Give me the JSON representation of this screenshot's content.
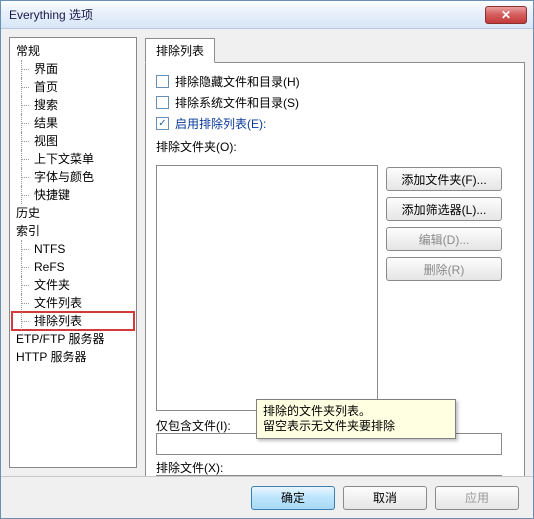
{
  "window": {
    "title": "Everything 选项",
    "close_glyph": "✕"
  },
  "tree": {
    "general": "常规",
    "children_general": [
      "界面",
      "首页",
      "搜索",
      "结果",
      "视图",
      "上下文菜单",
      "字体与颜色",
      "快捷键"
    ],
    "history": "历史",
    "index": "索引",
    "children_index": [
      "NTFS",
      "ReFS",
      "文件夹",
      "文件列表",
      "排除列表"
    ],
    "etp": "ETP/FTP 服务器",
    "http": "HTTP 服务器",
    "selected": "排除列表"
  },
  "tab": {
    "label": "排除列表"
  },
  "checks": {
    "hidden": "排除隐藏文件和目录(H)",
    "system": "排除系统文件和目录(S)",
    "enable": "启用排除列表(E):",
    "enable_checked": true
  },
  "labels": {
    "folders": "排除文件夹(O):",
    "include": "仅包含文件(I):",
    "exclude": "排除文件(X):"
  },
  "side_buttons": {
    "add_folder": "添加文件夹(F)...",
    "add_filter": "添加筛选器(L)...",
    "edit": "编辑(D)...",
    "remove": "删除(R)"
  },
  "tooltip": {
    "line1": "排除的文件夹列表。",
    "line2": "留空表示无文件夹要排除"
  },
  "footer": {
    "ok": "确定",
    "cancel": "取消",
    "apply": "应用"
  }
}
